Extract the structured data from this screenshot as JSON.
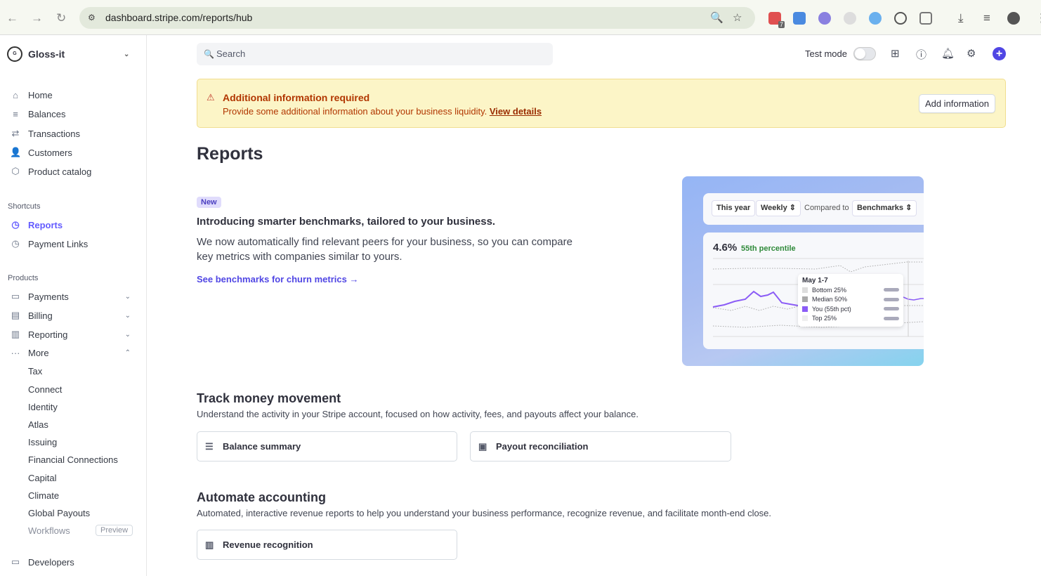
{
  "browser": {
    "url": "dashboard.stripe.com/reports/hub",
    "ext_badge": "7"
  },
  "account": {
    "name": "Gloss-it",
    "logo_text": "gloss it"
  },
  "sidebar": {
    "main": [
      {
        "label": "Home",
        "icon": "home-icon"
      },
      {
        "label": "Balances",
        "icon": "balances-icon"
      },
      {
        "label": "Transactions",
        "icon": "transactions-icon"
      },
      {
        "label": "Customers",
        "icon": "customers-icon"
      },
      {
        "label": "Product catalog",
        "icon": "product-icon"
      }
    ],
    "shortcuts_title": "Shortcuts",
    "shortcuts": [
      {
        "label": "Reports"
      },
      {
        "label": "Payment Links"
      }
    ],
    "products_title": "Products",
    "products": [
      {
        "label": "Payments"
      },
      {
        "label": "Billing"
      },
      {
        "label": "Reporting"
      },
      {
        "label": "More"
      }
    ],
    "more_items": [
      "Tax",
      "Connect",
      "Identity",
      "Atlas",
      "Issuing",
      "Financial Connections",
      "Capital",
      "Climate",
      "Global Payouts"
    ],
    "workflows": "Workflows",
    "preview": "Preview",
    "developers": "Developers"
  },
  "header": {
    "search_placeholder": "Search",
    "test_mode": "Test mode",
    "test_mode_on": false
  },
  "banner": {
    "title": "Additional information required",
    "text": "Provide some additional information about your business liquidity.",
    "link": "View details",
    "button": "Add information"
  },
  "page": {
    "title": "Reports",
    "badge": "New",
    "intro_title": "Introducing smarter benchmarks, tailored to your business.",
    "intro_text": "We now automatically find relevant peers for your business, so you can compare key metrics with companies similar to yours.",
    "intro_link": "See benchmarks for churn metrics"
  },
  "preview": {
    "range": "This year",
    "interval": "Weekly",
    "compared": "Compared to",
    "benchmark": "Benchmarks",
    "value": "4.6%",
    "percentile": "55th percentile",
    "tooltip_title": "May 1-7",
    "legend": [
      "Bottom 25%",
      "Median 50%",
      "You (55th pct)",
      "Top 25%"
    ]
  },
  "sections": [
    {
      "title": "Track money movement",
      "desc": "Understand the activity in your Stripe account, focused on how activity, fees, and payouts affect your balance.",
      "reports": [
        "Balance summary",
        "Payout reconciliation"
      ]
    },
    {
      "title": "Automate accounting",
      "desc": "Automated, interactive revenue reports to help you understand your business performance, recognize revenue, and facilitate month-end close.",
      "reports": [
        "Revenue recognition"
      ]
    }
  ],
  "colors": {
    "accent": "#635bff",
    "banner_bg": "#fcf5c7",
    "warning": "#b13600"
  }
}
